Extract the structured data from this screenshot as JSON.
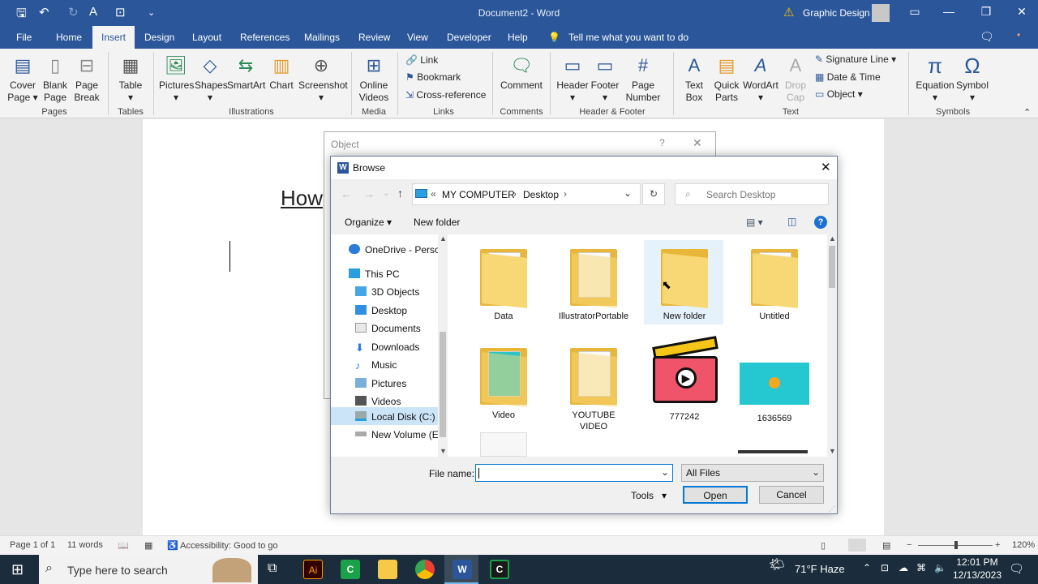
{
  "titlebar": {
    "doc_title": "Document2  -  Word",
    "user": "Graphic Design",
    "icons": [
      "save-icon",
      "undo-icon",
      "redo-icon",
      "font-color-icon",
      "touch-mode-icon",
      "customize-icon"
    ]
  },
  "tabs": [
    "File",
    "Home",
    "Insert",
    "Design",
    "Layout",
    "References",
    "Mailings",
    "Review",
    "View",
    "Developer",
    "Help"
  ],
  "active_tab": "Insert",
  "tell_me": "Tell me what you want to do",
  "ribbon": {
    "pages": {
      "cover": "Cover Page",
      "blank": "Blank Page",
      "break": "Page Break",
      "label": "Pages"
    },
    "tables": {
      "table": "Table",
      "label": "Tables"
    },
    "illustrations": {
      "pictures": "Pictures",
      "shapes": "Shapes",
      "smartart": "SmartArt",
      "chart": "Chart",
      "screenshot": "Screenshot",
      "label": "Illustrations"
    },
    "media": {
      "online_videos": "Online Videos",
      "label": "Media"
    },
    "links": {
      "link": "Link",
      "bookmark": "Bookmark",
      "cross_ref": "Cross-reference",
      "label": "Links"
    },
    "comments": {
      "comment": "Comment",
      "label": "Comments"
    },
    "header_footer": {
      "header": "Header",
      "footer": "Footer",
      "page_number": "Page Number",
      "label": "Header & Footer"
    },
    "text": {
      "text_box": "Text Box",
      "quick_parts": "Quick Parts",
      "wordart": "WordArt",
      "drop_cap": "Drop Cap",
      "signature": "Signature Line",
      "datetime": "Date & Time",
      "object": "Object",
      "label": "Text"
    },
    "symbols": {
      "equation": "Equation",
      "symbol": "Symbol",
      "label": "Symbols"
    }
  },
  "document": {
    "heading_fragment": "How"
  },
  "object_dialog": {
    "title": "Object"
  },
  "browse": {
    "title": "Browse",
    "path": [
      "MY COMPUTER",
      "Desktop"
    ],
    "search_placeholder": "Search Desktop",
    "organize": "Organize",
    "new_folder": "New folder",
    "nav": [
      "OneDrive - Person",
      "This PC",
      "3D Objects",
      "Desktop",
      "Documents",
      "Downloads",
      "Music",
      "Pictures",
      "Videos",
      "Local Disk (C:)",
      "New Volume (E:)"
    ],
    "files": [
      "Data",
      "IllustratorPortable",
      "New folder",
      "Untitled",
      "Video",
      "YOUTUBE VIDEO",
      "777242",
      "1636569"
    ],
    "file_name_label": "File name:",
    "file_name_value": "",
    "filter": "All Files",
    "tools": "Tools",
    "open": "Open",
    "cancel": "Cancel"
  },
  "status": {
    "page": "Page 1 of 1",
    "words": "11 words",
    "accessibility": "Accessibility: Good to go",
    "zoom": "120%"
  },
  "taskbar": {
    "search_placeholder": "Type here to search",
    "weather": "71°F  Haze",
    "time": "12:01 PM",
    "date": "12/13/2023"
  },
  "colors": {
    "word_blue": "#2b579a",
    "folder_yellow": "#f8d775",
    "accent": "#0078d7"
  }
}
